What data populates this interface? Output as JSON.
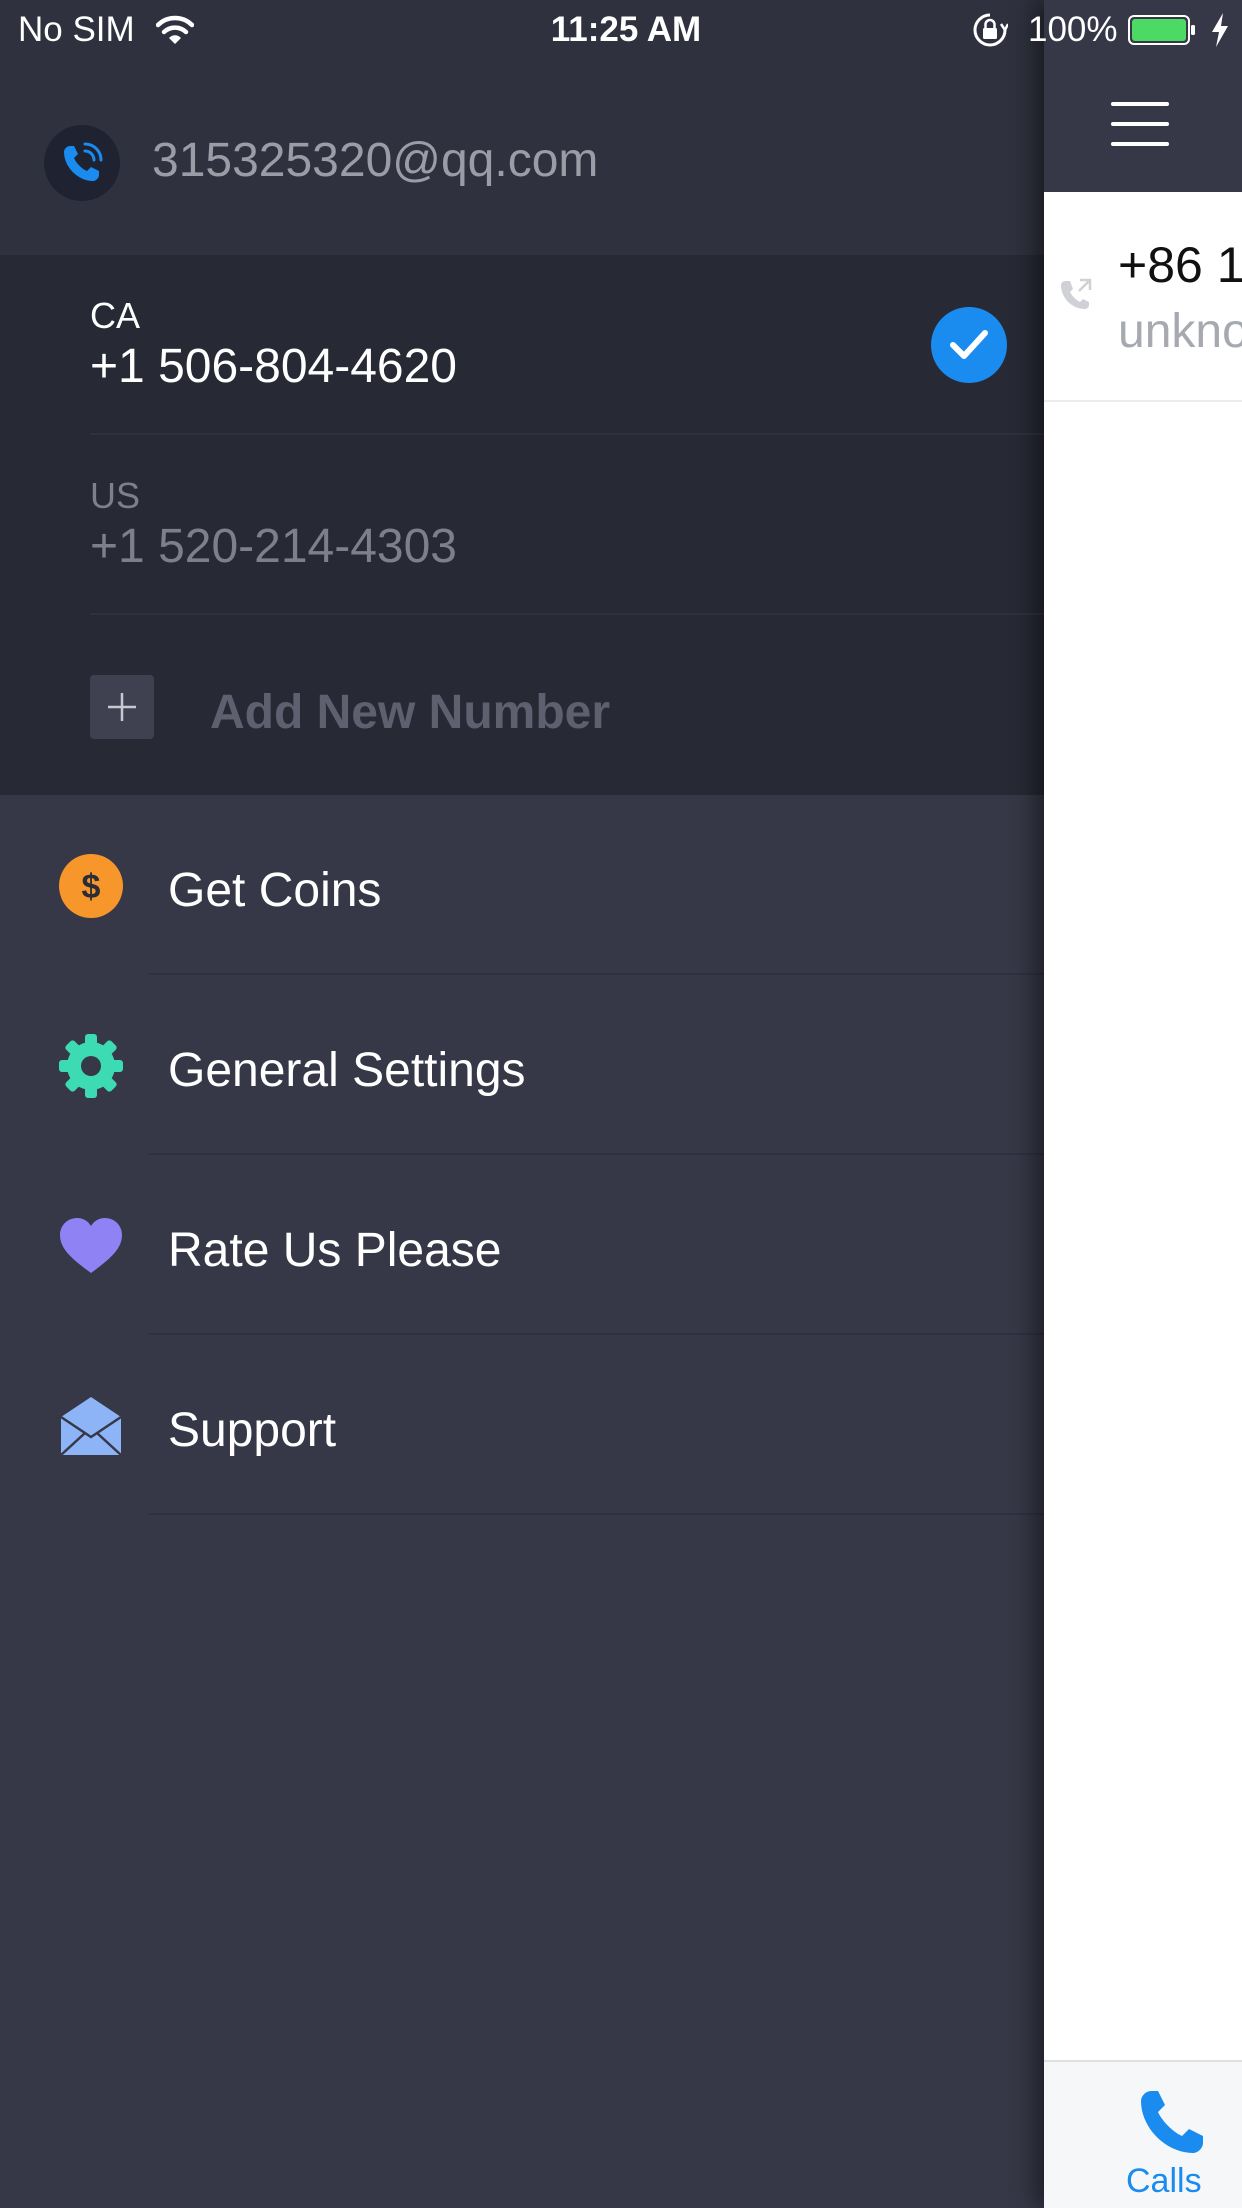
{
  "status_bar": {
    "carrier": "No SIM",
    "time": "11:25 AM",
    "battery_percent": "100%",
    "icons": [
      "wifi-icon",
      "orientation-lock-icon",
      "battery-icon",
      "charging-bolt-icon"
    ]
  },
  "drawer": {
    "account": {
      "email": "315325320@qq.com",
      "avatar_icon": "phone-call-icon"
    },
    "numbers": [
      {
        "country": "CA",
        "number": "+1 506-804-4620",
        "selected": true
      },
      {
        "country": "US",
        "number": "+1 520-214-4303",
        "selected": false
      }
    ],
    "add_number_label": "Add New Number",
    "menu": [
      {
        "label": "Get Coins",
        "icon": "coin-icon",
        "icon_color": "#f7962b"
      },
      {
        "label": "General Settings",
        "icon": "gear-icon",
        "icon_color": "#3ddbb3"
      },
      {
        "label": "Rate Us Please",
        "icon": "heart-icon",
        "icon_color": "#8f82f5"
      },
      {
        "label": "Support",
        "icon": "envelope-icon",
        "icon_color": "#8db4f7"
      }
    ]
  },
  "main": {
    "recent_call": {
      "number": "+86 1",
      "subtitle": "unkno"
    },
    "tab": {
      "label": "Calls",
      "icon": "phone-icon"
    }
  },
  "colors": {
    "accent": "#1a8cf0",
    "drawer_bg": "#363847",
    "numbers_bg": "#272935"
  }
}
